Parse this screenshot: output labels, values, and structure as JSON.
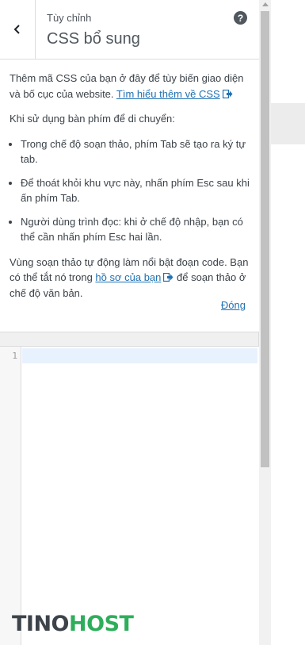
{
  "header": {
    "breadcrumb": "Tùy chỉnh",
    "title": "CSS bổ sung",
    "back_icon": "chevron-left-icon",
    "help_icon": "help-icon"
  },
  "help": {
    "intro_text": "Thêm mã CSS của bạn ở đây để tùy biến giao diện và bố cục của website.",
    "learn_more_link": "Tìm hiểu thêm về CSS",
    "keyboard_heading": "Khi sử dụng bàn phím để di chuyển:",
    "bullets": [
      "Trong chế độ soạn thảo, phím Tab sẽ tạo ra ký tự tab.",
      "Để thoát khỏi khu vực này, nhấn phím Esc sau khi ấn phím Tab.",
      "Người dùng trình đọc: khi ở chế độ nhập, bạn có thể cần nhấn phím Esc hai lần."
    ],
    "highlight_text_before": "Vùng soạn thảo tự động làm nổi bật đoạn code. Bạn có thể tắt nó trong",
    "profile_link": "hồ sơ của bạn",
    "highlight_text_after": "để soạn thảo ở chế độ văn bản.",
    "close_link": "Đóng"
  },
  "editor": {
    "line_numbers": [
      "1"
    ]
  },
  "watermark": {
    "part1": "TINO",
    "part2": "HOST"
  },
  "colors": {
    "accent_link": "#2271b1",
    "text": "#3c434a",
    "logo_green": "#2eae5b"
  }
}
